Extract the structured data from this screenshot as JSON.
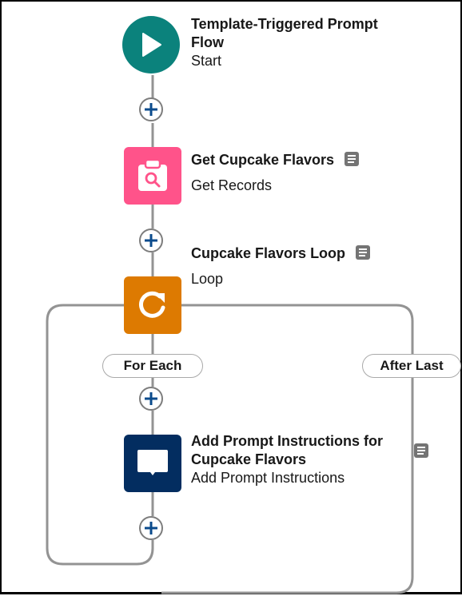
{
  "colors": {
    "start": "#0b827c",
    "get_records": "#ff538a",
    "loop": "#dd7a01",
    "prompt": "#032d60",
    "connector": "#939393",
    "add_plus": "#0b4b8c",
    "doc_icon": "#747474"
  },
  "nodes": {
    "start": {
      "title": "Template-Triggered Prompt Flow",
      "title_line1": "Template-Triggered Prompt",
      "title_line2": "Flow",
      "type": "Start",
      "icon": "play-icon"
    },
    "get_records": {
      "title": "Get Cupcake Flavors",
      "type": "Get Records",
      "icon": "record-lookup-icon",
      "has_description": true
    },
    "loop": {
      "title": "Cupcake Flavors Loop",
      "type": "Loop",
      "icon": "loop-icon",
      "has_description": true
    },
    "prompt": {
      "title": "Add Prompt Instructions for Cupcake Flavors",
      "title_line1": "Add Prompt Instructions for",
      "title_line2": "Cupcake Flavors",
      "type": "Add Prompt Instructions",
      "icon": "prompt-instructions-icon",
      "has_description": true
    }
  },
  "branches": {
    "for_each": "For Each",
    "after_last": "After Last"
  },
  "add_buttons": [
    "after-start",
    "after-get-records",
    "for-each-first",
    "for-each-after-prompt"
  ]
}
